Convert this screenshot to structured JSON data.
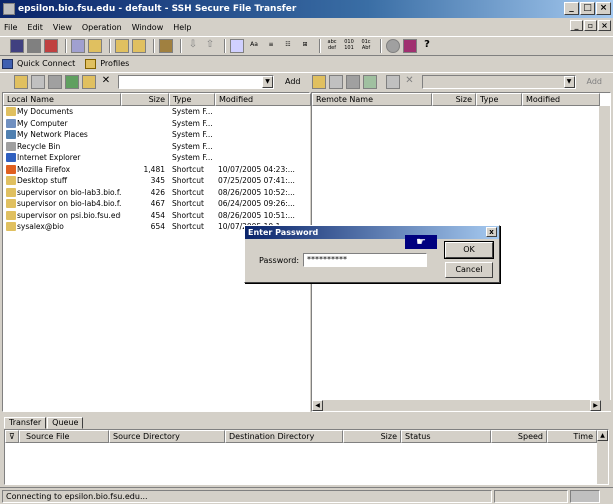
{
  "window": {
    "title": "epsilon.bio.fsu.edu - default - SSH Secure File Transfer"
  },
  "menu": [
    "File",
    "Edit",
    "View",
    "Operation",
    "Window",
    "Help"
  ],
  "toolbar_icons": [
    "save-icon",
    "print-icon",
    "disconnect-icon",
    "copy-icon",
    "paste-icon",
    "new-folder-icon",
    "up-folder-icon",
    "sync-icon",
    "download-icon",
    "upload-icon",
    "terminal-icon",
    "font-icon",
    "list-icon",
    "details-icon",
    "tree-icon",
    "ascii-icon",
    "binary-icon",
    "auto-icon",
    "stop-icon",
    "profile-icon",
    "help-icon"
  ],
  "toolbar_text": {
    "abc": "abc\ndef",
    "bin": "010\n101",
    "auto": "01c\nAbf"
  },
  "shortcuts": [
    {
      "label": "Quick Connect"
    },
    {
      "label": "Profiles"
    }
  ],
  "local": {
    "add_label": "Add",
    "columns": [
      "Local Name",
      "Size",
      "Type",
      "Modified"
    ],
    "files": [
      {
        "name": "My Documents",
        "size": "",
        "type": "System F...",
        "modified": "",
        "icon": "folder",
        "color": "#e0c060"
      },
      {
        "name": "My Computer",
        "size": "",
        "type": "System F...",
        "modified": "",
        "icon": "computer",
        "color": "#7090c0"
      },
      {
        "name": "My Network Places",
        "size": "",
        "type": "System F...",
        "modified": "",
        "icon": "network",
        "color": "#5080b0"
      },
      {
        "name": "Recycle Bin",
        "size": "",
        "type": "System F...",
        "modified": "",
        "icon": "recycle",
        "color": "#a0a0a0"
      },
      {
        "name": "Internet Explorer",
        "size": "",
        "type": "System F...",
        "modified": "",
        "icon": "ie",
        "color": "#3060c0"
      },
      {
        "name": "Mozilla Firefox",
        "size": "1,481",
        "type": "Shortcut",
        "modified": "10/07/2005 04:23:...",
        "icon": "firefox",
        "color": "#e06020"
      },
      {
        "name": "Desktop stuff",
        "size": "345",
        "type": "Shortcut",
        "modified": "07/25/2005 07:41:...",
        "icon": "folder",
        "color": "#e0c060"
      },
      {
        "name": "supervisor on bio-lab3.bio.f...",
        "size": "426",
        "type": "Shortcut",
        "modified": "08/26/2005 10:52:...",
        "icon": "ssh",
        "color": "#e0c060"
      },
      {
        "name": "supervisor on bio-lab4.bio.f...",
        "size": "467",
        "type": "Shortcut",
        "modified": "06/24/2005 09:26:...",
        "icon": "ssh",
        "color": "#e0c060"
      },
      {
        "name": "supervisor on psi.bio.fsu.edu",
        "size": "454",
        "type": "Shortcut",
        "modified": "08/26/2005 10:51:...",
        "icon": "ssh",
        "color": "#e0c060"
      },
      {
        "name": "sysalex@bio",
        "size": "654",
        "type": "Shortcut",
        "modified": "10/07/2005 10:1...",
        "icon": "ssh",
        "color": "#e0c060"
      }
    ]
  },
  "remote": {
    "add_label": "Add",
    "columns": [
      "Remote Name",
      "Size",
      "Type",
      "Modified"
    ]
  },
  "transfer": {
    "tabs": [
      "Transfer",
      "Queue"
    ],
    "columns": [
      "Source File",
      "Source Directory",
      "Destination Directory",
      "Size",
      "Status",
      "Speed",
      "Time"
    ]
  },
  "dialog": {
    "title": "Enter Password",
    "close": "x",
    "password_label": "Password:",
    "password_value": "**********",
    "ok_label": "OK",
    "cancel_label": "Cancel"
  },
  "status": {
    "text": "Connecting to epsilon.bio.fsu.edu..."
  }
}
